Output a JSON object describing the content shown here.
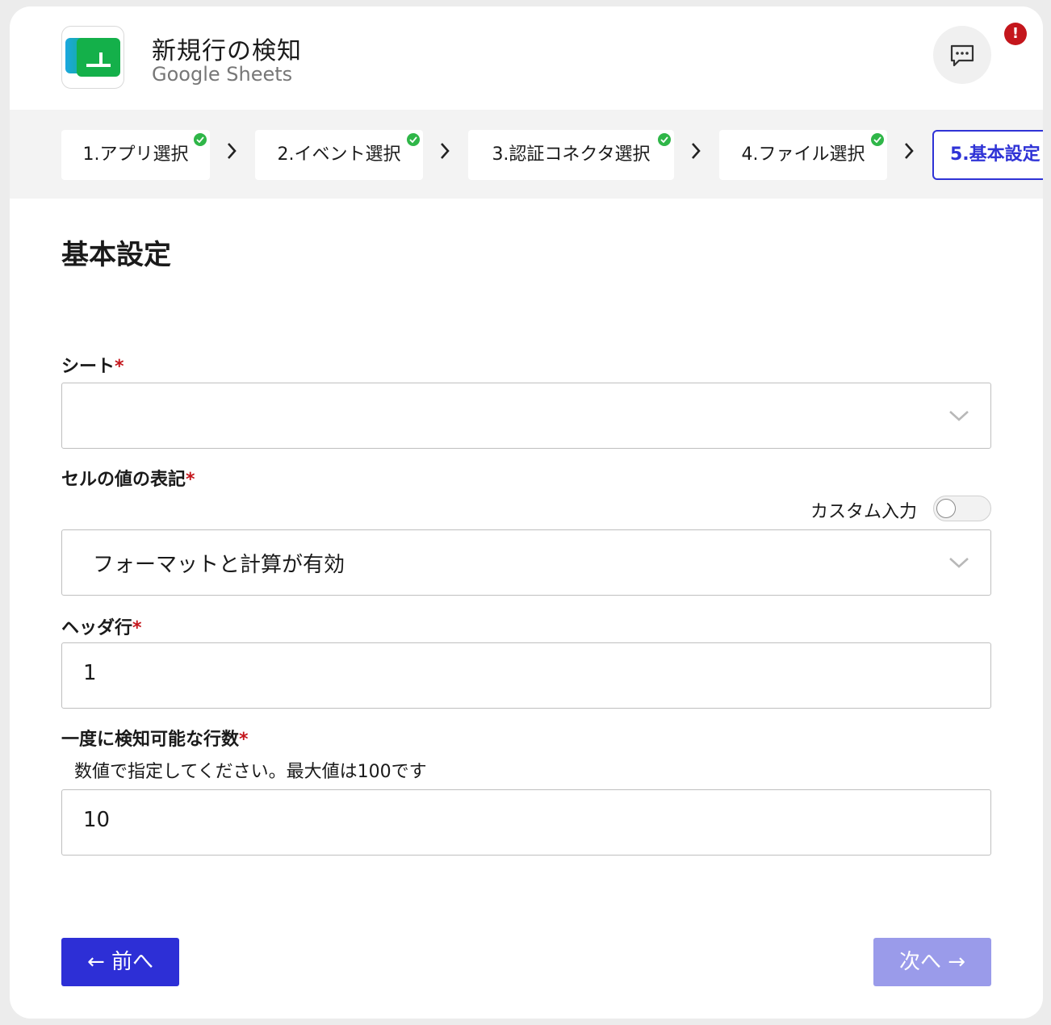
{
  "header": {
    "title": "新規行の検知",
    "subtitle": "Google Sheets",
    "alert": "!"
  },
  "steps": [
    {
      "label": "1.アプリ選択",
      "done": true
    },
    {
      "label": "2.イベント選択",
      "done": true
    },
    {
      "label": "3.認証コネクタ選択",
      "done": true
    },
    {
      "label": "4.ファイル選択",
      "done": true
    },
    {
      "label": "5.基本設定",
      "done": false,
      "active": true
    }
  ],
  "form": {
    "title": "基本設定",
    "required_mark": "*",
    "sheet": {
      "label": "シート",
      "value": ""
    },
    "cell_format": {
      "label": "セルの値の表記",
      "custom_input_label": "カスタム入力",
      "custom_input_on": false,
      "value": "フォーマットと計算が有効"
    },
    "header_row": {
      "label": "ヘッダ行",
      "value": "1"
    },
    "rows_per_detect": {
      "label": "一度に検知可能な行数",
      "hint": "数値で指定してください。最大値は100です",
      "value": "10"
    }
  },
  "nav": {
    "prev_label": "← 前へ",
    "next_label": "次へ →"
  },
  "colors": {
    "primary": "#2d2fd6",
    "disabled": "#9a9bea",
    "required": "#c4161c",
    "check": "#2fb648"
  }
}
